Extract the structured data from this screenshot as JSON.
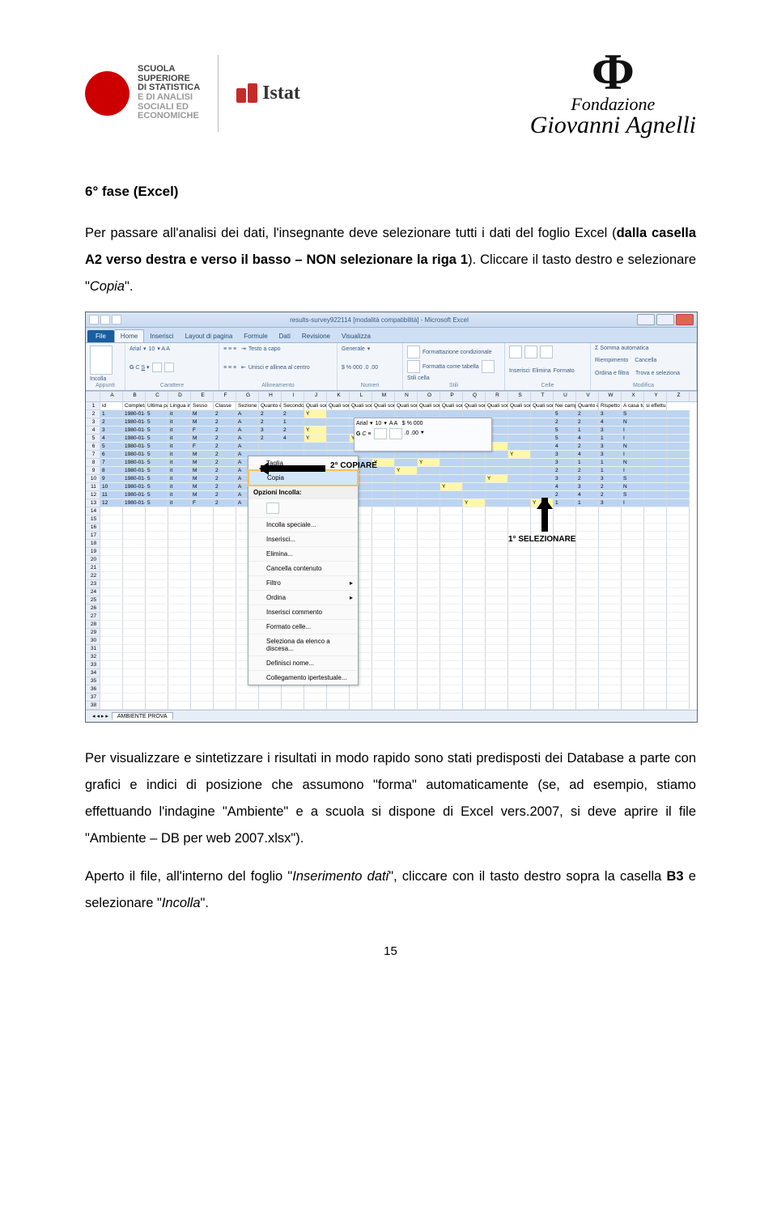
{
  "logos": {
    "scuola": {
      "line1": "SCUOLA",
      "line2": "SUPERIORE",
      "line3": "DI STATISTICA",
      "line4": "E DI ANALISI",
      "line5": "SOCIALI ED",
      "line6": "ECONOMICHE"
    },
    "istat": "Istat",
    "agnelli_line1": "Fondazione",
    "agnelli_line2": "Giovanni Agnelli"
  },
  "section_title": "6° fase (Excel)",
  "para1_a": "Per passare all'analisi dei dati, l'insegnante deve selezionare tutti i dati del foglio Excel (",
  "para1_b": "dalla casella A2 verso destra e verso il basso – NON selezionare la riga 1",
  "para1_c": "). Cliccare il tasto destro e selezionare \"",
  "para1_d": "Copia",
  "para1_e": "\".",
  "para2_a": "Per visualizzare e sintetizzare i risultati in modo rapido sono stati predisposti dei Database a parte con grafici e indici di posizione che assumono \"forma\" automaticamente (se, ad esempio, stiamo effettuando l'indagine \"Ambiente\" e a scuola si dispone di Excel vers.2007, si deve aprire il file \"Ambiente – DB per web 2007.xlsx\").",
  "para3_a": "Aperto il file, all'interno del foglio \"",
  "para3_b": "Inserimento dati",
  "para3_c": "\", cliccare con il tasto destro sopra la casella ",
  "para3_d": "B3",
  "para3_e": " e selezionare \"",
  "para3_f": "Incolla",
  "para3_g": "\".",
  "page_number": "15",
  "excel": {
    "title": "results-survey922114 [modalità compatibilità] - Microsoft Excel",
    "tabs": {
      "file": "File",
      "home": "Home",
      "inserisci": "Inserisci",
      "layout": "Layout di pagina",
      "formule": "Formule",
      "dati": "Dati",
      "revisione": "Revisione",
      "visualizza": "Visualizza"
    },
    "ribbon_groups": {
      "appunti": "Appunti",
      "carattere": "Carattere",
      "allineamento": "Allineamento",
      "numeri": "Numeri",
      "stili": "Stili",
      "celle": "Celle",
      "modifica": "Modifica"
    },
    "ribbon_controls": {
      "incolla": "Incolla",
      "font": "Arial",
      "fontsize": "10",
      "testo_a_capo": "Testo a capo",
      "unisci": "Unisci e allinea al centro",
      "generale": "Generale",
      "fc": "Formattazione condizionale",
      "ft": "Formatta come tabella",
      "sc": "Stili cella",
      "ins": "Inserisci",
      "del": "Elimina",
      "fmt": "Formato",
      "somma": "Σ Somma automatica",
      "riemp": "Riempimento",
      "canc": "Cancella",
      "ordina": "Ordina e filtra",
      "trova": "Trova e seleziona"
    },
    "columns": [
      "A",
      "B",
      "C",
      "D",
      "E",
      "F",
      "G",
      "H",
      "I",
      "J",
      "K",
      "L",
      "M",
      "N",
      "O",
      "P",
      "Q",
      "R",
      "S",
      "T",
      "U",
      "V",
      "W",
      "X",
      "Y",
      "Z"
    ],
    "header_row": [
      "id",
      "Completat.",
      "Ultima pa",
      "Lingua ini",
      "Sesso",
      "Classe",
      "Sezione",
      "Quanto è i",
      "Secondo t",
      "Quali sono",
      "Quali sono",
      "Quali sono",
      "Quali sono",
      "Quali sono",
      "Quali sono",
      "Quali sono",
      "Quali sono",
      "Quali sono",
      "Quali sono",
      "Quali sono",
      "Nei campi",
      "Quanto è i",
      "Rispetto a",
      "A casa tua",
      "si effettua la racco"
    ],
    "data_rows": [
      [
        "1",
        "1980-01-0",
        "5",
        "it",
        "M",
        "2",
        "A",
        "2",
        "2",
        "Y",
        "",
        "",
        "",
        "",
        "",
        "",
        "",
        "",
        "",
        "",
        "5",
        "2",
        "3",
        "S",
        ""
      ],
      [
        "2",
        "1980-01-0",
        "5",
        "it",
        "M",
        "2",
        "A",
        "2",
        "1",
        "",
        "",
        "",
        "",
        "Y",
        "",
        "",
        "",
        "",
        "",
        "",
        "2",
        "2",
        "4",
        "N",
        ""
      ],
      [
        "3",
        "1980-01-0",
        "5",
        "it",
        "F",
        "2",
        "A",
        "3",
        "2",
        "Y",
        "",
        "",
        "Y",
        "",
        "",
        "",
        "",
        "",
        "",
        "",
        "5",
        "1",
        "3",
        "I",
        ""
      ],
      [
        "4",
        "1980-01-0",
        "5",
        "it",
        "M",
        "2",
        "A",
        "2",
        "4",
        "Y",
        "",
        "Y",
        "",
        "",
        "",
        "",
        "",
        "",
        "",
        "",
        "5",
        "4",
        "1",
        "I",
        ""
      ],
      [
        "5",
        "1980-01-0",
        "5",
        "it",
        "F",
        "2",
        "A",
        "",
        "",
        "",
        "",
        "",
        "",
        "",
        "Y",
        "",
        "",
        "Y",
        "",
        "",
        "4",
        "2",
        "3",
        "N",
        ""
      ],
      [
        "6",
        "1980-01-0",
        "5",
        "it",
        "M",
        "2",
        "A",
        "",
        "",
        "",
        "",
        "",
        "",
        "",
        "",
        "",
        "",
        "",
        "Y",
        "",
        "3",
        "4",
        "3",
        "I",
        ""
      ],
      [
        "7",
        "1980-01-0",
        "5",
        "it",
        "M",
        "2",
        "A",
        "",
        "",
        "",
        "",
        "",
        "Y",
        "",
        "Y",
        "",
        "",
        "",
        "",
        "",
        "3",
        "1",
        "1",
        "N",
        ""
      ],
      [
        "8",
        "1980-01-0",
        "5",
        "it",
        "M",
        "2",
        "A",
        "",
        "",
        "",
        "",
        "",
        "",
        "Y",
        "",
        "",
        "",
        "",
        "",
        "",
        "2",
        "2",
        "1",
        "I",
        ""
      ],
      [
        "9",
        "1980-01-0",
        "5",
        "it",
        "M",
        "2",
        "A",
        "",
        "",
        "",
        "",
        "",
        "",
        "",
        "",
        "",
        "",
        "Y",
        "",
        "",
        "3",
        "2",
        "3",
        "S",
        ""
      ],
      [
        "10",
        "1980-01-0",
        "5",
        "it",
        "M",
        "2",
        "A",
        "",
        "",
        "",
        "",
        "",
        "",
        "",
        "",
        "Y",
        "",
        "",
        "",
        "",
        "4",
        "3",
        "2",
        "N",
        ""
      ],
      [
        "11",
        "1980-01-0",
        "5",
        "it",
        "M",
        "2",
        "A",
        "",
        "",
        "",
        "",
        "",
        "",
        "",
        "",
        "",
        "",
        "",
        "",
        "",
        "2",
        "4",
        "2",
        "S",
        ""
      ],
      [
        "12",
        "1980-01-0",
        "5",
        "it",
        "F",
        "2",
        "A",
        "",
        "",
        "",
        "",
        "",
        "",
        "",
        "",
        "",
        "Y",
        "",
        "",
        "Y",
        "1",
        "1",
        "3",
        "I",
        ""
      ]
    ],
    "empty_rows_start": 14,
    "empty_rows_end": 38,
    "sheet_tab": "AMBIENTE PROVA",
    "context_menu": {
      "taglia": "Taglia",
      "copia": "Copia",
      "opzioni": "Opzioni Incolla:",
      "incolla_speciale": "Incolla speciale...",
      "inserisci": "Inserisci...",
      "elimina": "Elimina...",
      "cancella": "Cancella contenuto",
      "filtro": "Filtro",
      "ordina": "Ordina",
      "commento": "Inserisci commento",
      "formato": "Formato celle...",
      "elenco": "Seleziona da elenco a discesa...",
      "nome": "Definisci nome...",
      "collegamento": "Collegamento ipertestuale..."
    },
    "annotation1": "2° COPIARE",
    "annotation2": "1° SELEZIONARE",
    "minitoolbar": {
      "font": "Arial",
      "size": "10"
    }
  }
}
